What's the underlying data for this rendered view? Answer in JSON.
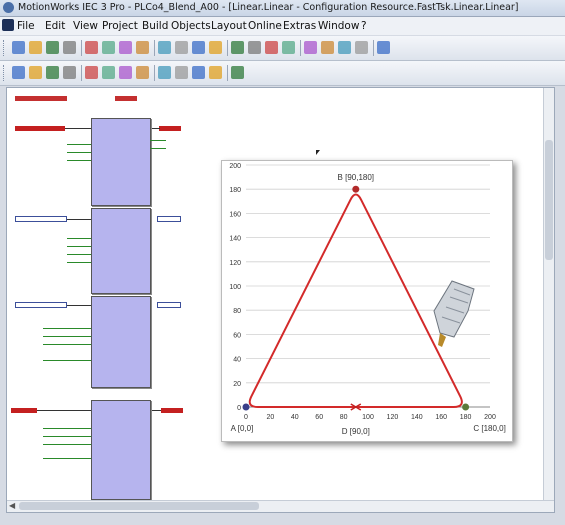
{
  "window": {
    "title": "MotionWorks IEC 3 Pro - PLCo4_Blend_A00 - [Linear.Linear - Configuration Resource.FastTsk.Linear.Linear]"
  },
  "menu": {
    "items": [
      "File",
      "Edit",
      "View",
      "Project",
      "Build",
      "Objects",
      "Layout",
      "Online",
      "Extras",
      "Window",
      "?"
    ]
  },
  "toolbar": {
    "row1_icons": [
      "new-icon",
      "open-icon",
      "save-icon",
      "print-icon",
      "cut-icon",
      "copy-icon",
      "paste-icon",
      "undo-icon",
      "zoom-in-icon",
      "zoom-out-icon",
      "window-icon",
      "layout-icon",
      "pencil-icon",
      "monitor-icon",
      "gear-icon",
      "close-icon",
      "grid-icon",
      "settings-icon",
      "page-icon",
      "prev-icon",
      "next-icon"
    ],
    "row2_icons": [
      "select-icon",
      "pointer-icon",
      "connect-icon",
      "fb-icon",
      "block-icon",
      "var-icon",
      "comment-icon",
      "run-icon",
      "stop-icon",
      "debug-icon",
      "step-icon",
      "watch-icon",
      "align-icon"
    ]
  },
  "chart_data": {
    "type": "line",
    "series": [
      {
        "values": [
          [
            0,
            0
          ],
          [
            90,
            180
          ],
          [
            180,
            0
          ],
          [
            0,
            0
          ]
        ]
      }
    ],
    "points": [
      {
        "label": "A [0,0]",
        "x": 0,
        "y": 0,
        "color": "#3a3f8a"
      },
      {
        "label": "B [90,180]",
        "x": 90,
        "y": 180,
        "color": "#b22a2a"
      },
      {
        "label": "C [180,0]",
        "x": 180,
        "y": 0,
        "color": "#5b7a3a"
      },
      {
        "label": "D [90,0]",
        "x": 90,
        "y": 0,
        "color": "#c42020"
      }
    ],
    "x_ticks": [
      0,
      20,
      40,
      60,
      80,
      100,
      120,
      140,
      160,
      180,
      200
    ],
    "y_ticks": [
      0,
      20,
      40,
      60,
      80,
      100,
      120,
      140,
      160,
      180,
      200
    ],
    "xlim": [
      0,
      200
    ],
    "ylim": [
      0,
      200
    ],
    "grid": true,
    "line_color": "#d32a2a"
  }
}
